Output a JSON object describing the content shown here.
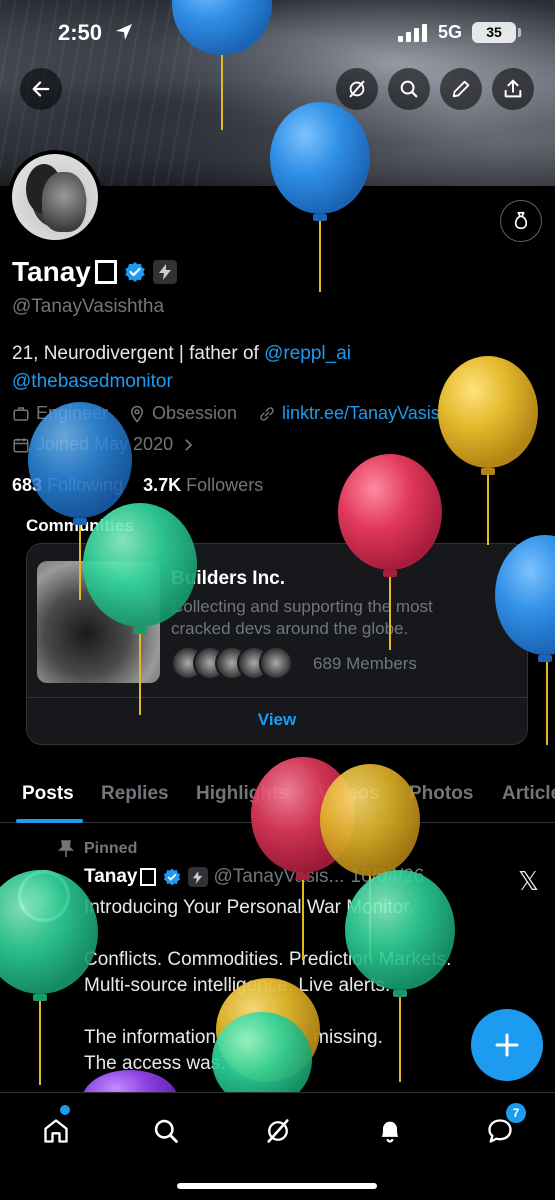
{
  "status": {
    "time": "2:50",
    "network": "5G",
    "battery": "35"
  },
  "profile": {
    "name": "Tanay",
    "handle": "@TanayVasishtha",
    "bio_prefix": "21, Neurodivergent | father of ",
    "bio_link1": "@reppl_ai",
    "bio_link2": "@thebasedmonitor",
    "job": "Engineer",
    "location": "Obsession",
    "website": "linktr.ee/TanayVasishtha",
    "joined": "Joined May 2020",
    "following_count": "683",
    "following_label": "Following",
    "followers_count": "3.7K",
    "followers_label": "Followers"
  },
  "communities": {
    "title": "Communities",
    "name": "Builders Inc.",
    "description": "Collecting and supporting the most cracked devs around the globe.",
    "members": "689 Members",
    "view_label": "View"
  },
  "tabs": [
    "Posts",
    "Replies",
    "Highlights",
    "Videos",
    "Photos",
    "Articles"
  ],
  "post": {
    "pinned_label": "Pinned",
    "author": "Tanay",
    "handle": "@TanayVasis...",
    "date": "16/04/26",
    "body": "Introducing Your Personal War Monitor.\n\nConflicts. Commodities. Prediction Markets.\nMulti-source intelligence. Live alerts.\n\nThe information was never missing.\nThe access was."
  },
  "bottom_nav": {
    "messages_badge": "7"
  },
  "icons": [
    "back-icon",
    "grok-icon",
    "search-icon",
    "edit-icon",
    "share-icon",
    "money-bag-icon",
    "briefcase-icon",
    "location-icon",
    "link-icon",
    "calendar-icon",
    "pin-icon",
    "home-icon",
    "bell-icon",
    "messages-icon",
    "plus-icon"
  ],
  "colors": {
    "accent": "#1d9bf0",
    "balloon_blue": "#2f8fe6",
    "balloon_yellow": "#e2b72a",
    "balloon_red": "#e0385a",
    "balloon_green": "#2ed39a"
  }
}
